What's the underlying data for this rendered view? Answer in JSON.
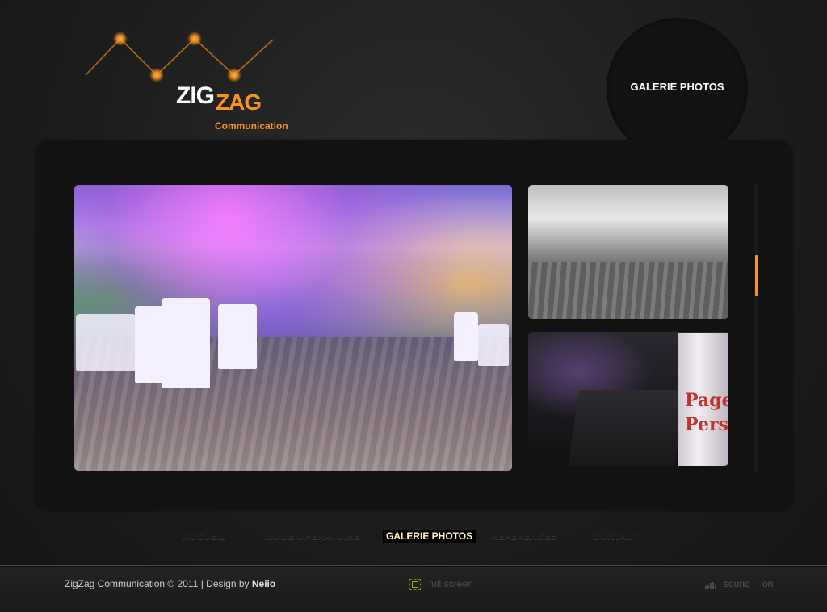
{
  "logo": {
    "zig": "ZIG",
    "zag": "ZAG",
    "tagline": "Communication",
    "accent_color": "#f7931e"
  },
  "section_title": "GALERIE PHOTOS",
  "gallery": {
    "photos": [
      {
        "name": "main-photo",
        "description_icon": "photo"
      },
      {
        "name": "thumbnail-bw",
        "description_icon": "photo"
      },
      {
        "name": "thumbnail-dark",
        "description_icon": "photo"
      }
    ],
    "display_text_line1": "Page",
    "display_text_line2": "Perso",
    "scroll_color": "#f7931e"
  },
  "nav": {
    "items": [
      {
        "label": "ACCUEIL",
        "active": false
      },
      {
        "label": "MODE OPERATOIRE",
        "active": false
      },
      {
        "label": "GALERIE PHOTOS",
        "active": true
      },
      {
        "label": "REFERENCES",
        "active": false
      },
      {
        "label": "CONTACT",
        "active": false
      }
    ],
    "separator": ":"
  },
  "footer": {
    "copyright": "ZigZag Communication © 2011 | Design by",
    "designer": "Neiio",
    "fullscreen_label": "full screen",
    "sound_label": "sound",
    "sound_state": "on"
  }
}
